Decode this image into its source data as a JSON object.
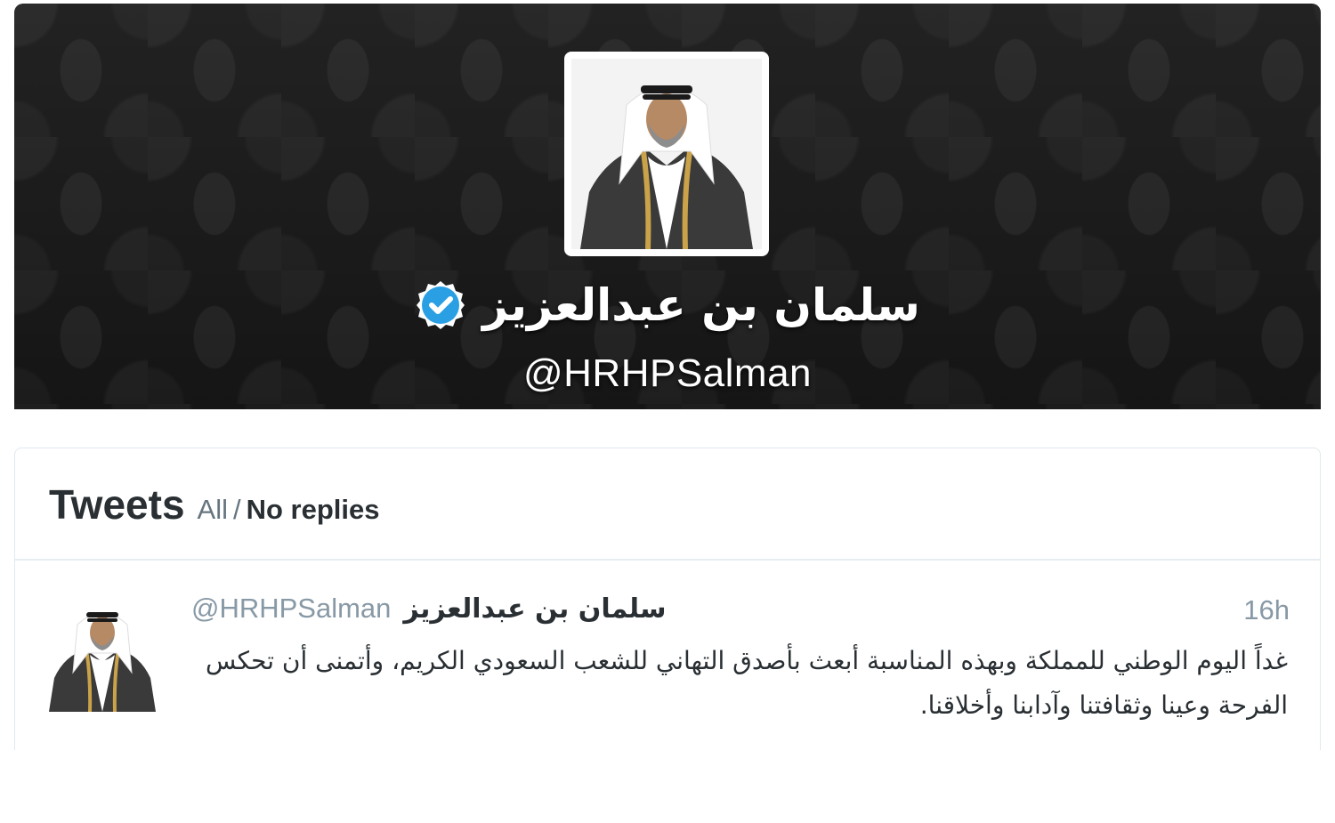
{
  "profile": {
    "display_name": "سلمان بن عبدالعزيز",
    "screen_name": "@HRHPSalman",
    "verified": true,
    "verified_badge_icon": "verified-badge-icon",
    "avatar_icon": "profile-avatar-photo",
    "verified_color": "#2a9fe3"
  },
  "tweets_section": {
    "title": "Tweets",
    "filter_all": "All",
    "filter_separator": "/",
    "filter_no_replies": "No replies"
  },
  "tweets": [
    {
      "screen_name": "@HRHPSalman",
      "display_name": "سلمان بن عبدالعزيز",
      "time": "16h",
      "text": "غداً اليوم الوطني للمملكة وبهذه المناسبة أبعث بأصدق التهاني للشعب السعودي الكريم، وأتمنى أن تحكس الفرحة وعينا وثقافتنا وآدابنا وأخلاقنا."
    }
  ]
}
